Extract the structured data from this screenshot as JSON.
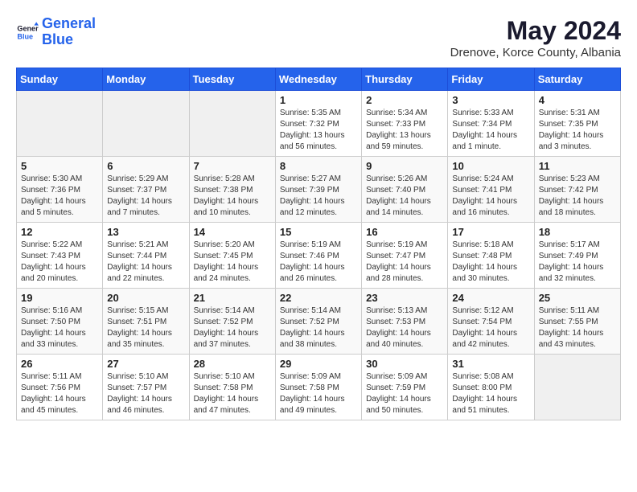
{
  "header": {
    "logo_line1": "General",
    "logo_line2": "Blue",
    "month_title": "May 2024",
    "subtitle": "Drenove, Korce County, Albania"
  },
  "weekdays": [
    "Sunday",
    "Monday",
    "Tuesday",
    "Wednesday",
    "Thursday",
    "Friday",
    "Saturday"
  ],
  "weeks": [
    [
      {
        "day": "",
        "content": ""
      },
      {
        "day": "",
        "content": ""
      },
      {
        "day": "",
        "content": ""
      },
      {
        "day": "1",
        "content": "Sunrise: 5:35 AM\nSunset: 7:32 PM\nDaylight: 13 hours\nand 56 minutes."
      },
      {
        "day": "2",
        "content": "Sunrise: 5:34 AM\nSunset: 7:33 PM\nDaylight: 13 hours\nand 59 minutes."
      },
      {
        "day": "3",
        "content": "Sunrise: 5:33 AM\nSunset: 7:34 PM\nDaylight: 14 hours\nand 1 minute."
      },
      {
        "day": "4",
        "content": "Sunrise: 5:31 AM\nSunset: 7:35 PM\nDaylight: 14 hours\nand 3 minutes."
      }
    ],
    [
      {
        "day": "5",
        "content": "Sunrise: 5:30 AM\nSunset: 7:36 PM\nDaylight: 14 hours\nand 5 minutes."
      },
      {
        "day": "6",
        "content": "Sunrise: 5:29 AM\nSunset: 7:37 PM\nDaylight: 14 hours\nand 7 minutes."
      },
      {
        "day": "7",
        "content": "Sunrise: 5:28 AM\nSunset: 7:38 PM\nDaylight: 14 hours\nand 10 minutes."
      },
      {
        "day": "8",
        "content": "Sunrise: 5:27 AM\nSunset: 7:39 PM\nDaylight: 14 hours\nand 12 minutes."
      },
      {
        "day": "9",
        "content": "Sunrise: 5:26 AM\nSunset: 7:40 PM\nDaylight: 14 hours\nand 14 minutes."
      },
      {
        "day": "10",
        "content": "Sunrise: 5:24 AM\nSunset: 7:41 PM\nDaylight: 14 hours\nand 16 minutes."
      },
      {
        "day": "11",
        "content": "Sunrise: 5:23 AM\nSunset: 7:42 PM\nDaylight: 14 hours\nand 18 minutes."
      }
    ],
    [
      {
        "day": "12",
        "content": "Sunrise: 5:22 AM\nSunset: 7:43 PM\nDaylight: 14 hours\nand 20 minutes."
      },
      {
        "day": "13",
        "content": "Sunrise: 5:21 AM\nSunset: 7:44 PM\nDaylight: 14 hours\nand 22 minutes."
      },
      {
        "day": "14",
        "content": "Sunrise: 5:20 AM\nSunset: 7:45 PM\nDaylight: 14 hours\nand 24 minutes."
      },
      {
        "day": "15",
        "content": "Sunrise: 5:19 AM\nSunset: 7:46 PM\nDaylight: 14 hours\nand 26 minutes."
      },
      {
        "day": "16",
        "content": "Sunrise: 5:19 AM\nSunset: 7:47 PM\nDaylight: 14 hours\nand 28 minutes."
      },
      {
        "day": "17",
        "content": "Sunrise: 5:18 AM\nSunset: 7:48 PM\nDaylight: 14 hours\nand 30 minutes."
      },
      {
        "day": "18",
        "content": "Sunrise: 5:17 AM\nSunset: 7:49 PM\nDaylight: 14 hours\nand 32 minutes."
      }
    ],
    [
      {
        "day": "19",
        "content": "Sunrise: 5:16 AM\nSunset: 7:50 PM\nDaylight: 14 hours\nand 33 minutes."
      },
      {
        "day": "20",
        "content": "Sunrise: 5:15 AM\nSunset: 7:51 PM\nDaylight: 14 hours\nand 35 minutes."
      },
      {
        "day": "21",
        "content": "Sunrise: 5:14 AM\nSunset: 7:52 PM\nDaylight: 14 hours\nand 37 minutes."
      },
      {
        "day": "22",
        "content": "Sunrise: 5:14 AM\nSunset: 7:52 PM\nDaylight: 14 hours\nand 38 minutes."
      },
      {
        "day": "23",
        "content": "Sunrise: 5:13 AM\nSunset: 7:53 PM\nDaylight: 14 hours\nand 40 minutes."
      },
      {
        "day": "24",
        "content": "Sunrise: 5:12 AM\nSunset: 7:54 PM\nDaylight: 14 hours\nand 42 minutes."
      },
      {
        "day": "25",
        "content": "Sunrise: 5:11 AM\nSunset: 7:55 PM\nDaylight: 14 hours\nand 43 minutes."
      }
    ],
    [
      {
        "day": "26",
        "content": "Sunrise: 5:11 AM\nSunset: 7:56 PM\nDaylight: 14 hours\nand 45 minutes."
      },
      {
        "day": "27",
        "content": "Sunrise: 5:10 AM\nSunset: 7:57 PM\nDaylight: 14 hours\nand 46 minutes."
      },
      {
        "day": "28",
        "content": "Sunrise: 5:10 AM\nSunset: 7:58 PM\nDaylight: 14 hours\nand 47 minutes."
      },
      {
        "day": "29",
        "content": "Sunrise: 5:09 AM\nSunset: 7:58 PM\nDaylight: 14 hours\nand 49 minutes."
      },
      {
        "day": "30",
        "content": "Sunrise: 5:09 AM\nSunset: 7:59 PM\nDaylight: 14 hours\nand 50 minutes."
      },
      {
        "day": "31",
        "content": "Sunrise: 5:08 AM\nSunset: 8:00 PM\nDaylight: 14 hours\nand 51 minutes."
      },
      {
        "day": "",
        "content": ""
      }
    ]
  ]
}
